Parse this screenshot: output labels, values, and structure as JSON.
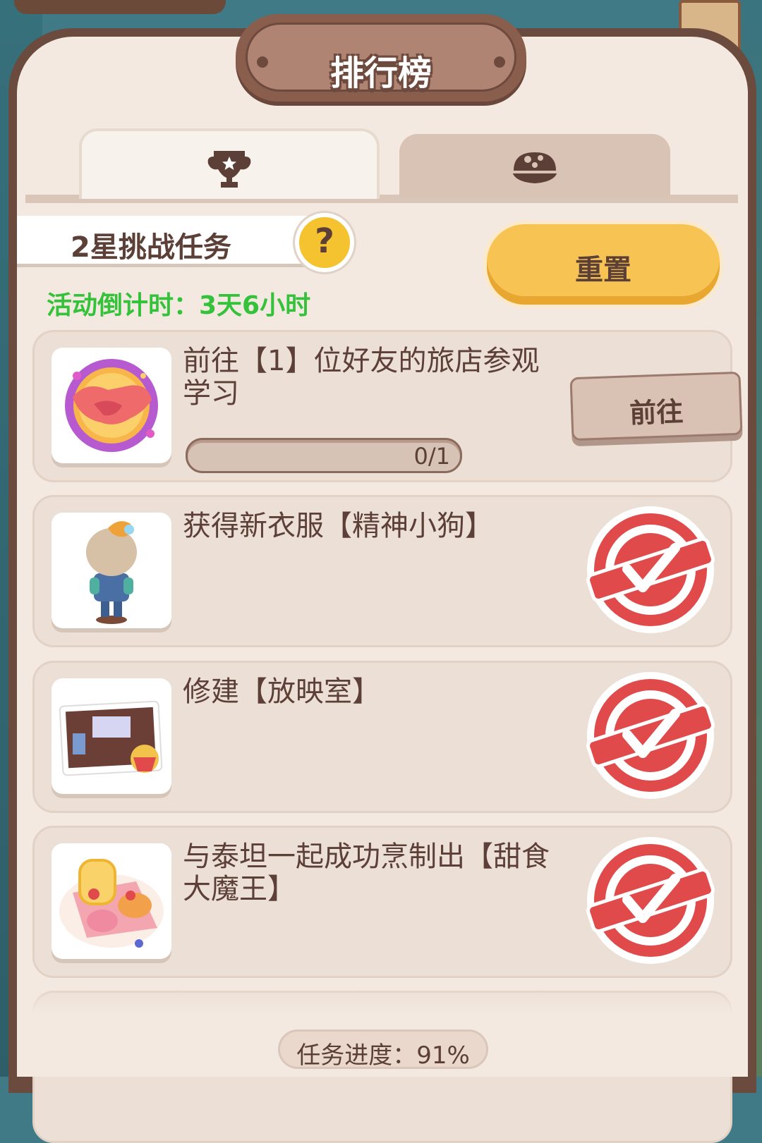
{
  "header": {
    "title": "排行榜"
  },
  "tabs": [
    {
      "icon": "trophy-icon",
      "active": true
    },
    {
      "icon": "dome-bowl-icon",
      "active": false
    }
  ],
  "challenge": {
    "label": "2星挑战任务",
    "help_glyph": "?",
    "countdown": "活动倒计时：3天6小时",
    "reset_label": "重置"
  },
  "tasks": [
    {
      "text": "前往【1】位好友的旅店参观学习",
      "progress_text": "0/1",
      "progress_fraction": 0,
      "action_label": "前往",
      "completed": false
    },
    {
      "text": "获得新衣服【精神小狗】",
      "completed": true
    },
    {
      "text": "修建【放映室】",
      "completed": true
    },
    {
      "text": "与泰坦一起成功烹制出【甜食大魔王】",
      "completed": true
    }
  ],
  "footer": {
    "progress_text": "任务进度：91%"
  },
  "colors": {
    "accent_green": "#34c23a",
    "button_yellow": "#f7c453",
    "stamp_red": "#e04a4a",
    "text_brown": "#5c4037"
  }
}
